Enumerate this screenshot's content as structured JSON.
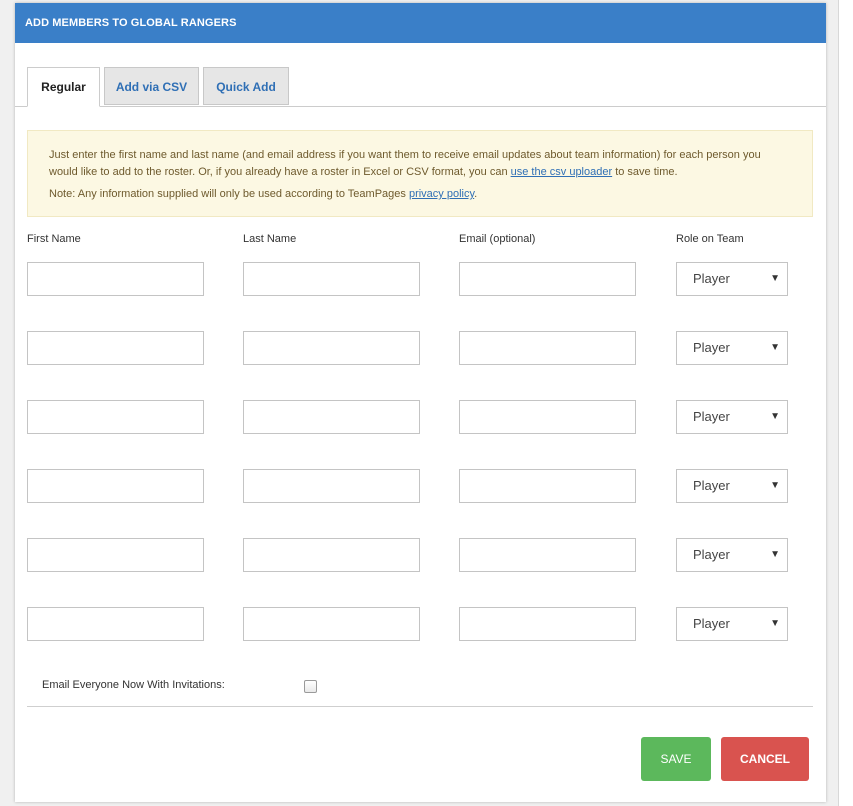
{
  "header": {
    "title": "ADD MEMBERS TO GLOBAL RANGERS"
  },
  "tabs": [
    {
      "label": "Regular",
      "active": true
    },
    {
      "label": "Add via CSV",
      "active": false
    },
    {
      "label": "Quick Add",
      "active": false
    }
  ],
  "notice": {
    "text_part1": "Just enter the first name and last name (and email address if you want them to receive email updates about team information) for each person you would like to add to the roster. Or, if you already have a roster in Excel or CSV format, you can ",
    "csv_link": "use the csv uploader",
    "text_part2": " to save time.",
    "note_prefix": "Note: Any information supplied will only be used according to TeamPages ",
    "privacy_link": "privacy policy",
    "note_suffix": "."
  },
  "columns": {
    "first_name": "First Name",
    "last_name": "Last Name",
    "email": "Email (optional)",
    "role": "Role on Team"
  },
  "rows": [
    {
      "first": "",
      "last": "",
      "email": "",
      "role": "Player"
    },
    {
      "first": "",
      "last": "",
      "email": "",
      "role": "Player"
    },
    {
      "first": "",
      "last": "",
      "email": "",
      "role": "Player"
    },
    {
      "first": "",
      "last": "",
      "email": "",
      "role": "Player"
    },
    {
      "first": "",
      "last": "",
      "email": "",
      "role": "Player"
    },
    {
      "first": "",
      "last": "",
      "email": "",
      "role": "Player"
    }
  ],
  "email_invite": {
    "label": "Email Everyone Now With Invitations:",
    "checked": false
  },
  "buttons": {
    "save": "SAVE",
    "cancel": "CANCEL"
  },
  "icons": {
    "dropdown": "caret-down-icon"
  },
  "colors": {
    "header": "#3a7fc8",
    "save": "#5cb85c",
    "cancel": "#d9534f",
    "notice_bg": "#fcf8e3",
    "link": "#2f6fb5"
  }
}
